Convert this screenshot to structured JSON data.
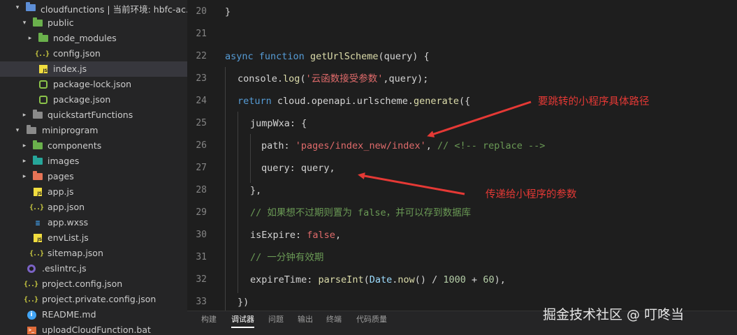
{
  "sidebar": {
    "items": [
      {
        "label": "cloudfunctions | 当前环境: hbfc-ac...",
        "icon": "folder-open-icon"
      },
      {
        "label": "public",
        "icon": "folder-open-icon"
      },
      {
        "label": "node_modules",
        "icon": "folder-icon"
      },
      {
        "label": "config.json",
        "icon": "json-icon"
      },
      {
        "label": "index.js",
        "icon": "js-icon"
      },
      {
        "label": "package-lock.json",
        "icon": "npm-icon"
      },
      {
        "label": "package.json",
        "icon": "npm-icon"
      },
      {
        "label": "quickstartFunctions",
        "icon": "folder-icon"
      },
      {
        "label": "miniprogram",
        "icon": "folder-open-icon"
      },
      {
        "label": "components",
        "icon": "folder-icon"
      },
      {
        "label": "images",
        "icon": "folder-icon"
      },
      {
        "label": "pages",
        "icon": "folder-icon"
      },
      {
        "label": "app.js",
        "icon": "js-icon"
      },
      {
        "label": "app.json",
        "icon": "json-icon"
      },
      {
        "label": "app.wxss",
        "icon": "css-icon"
      },
      {
        "label": "envList.js",
        "icon": "js-icon"
      },
      {
        "label": "sitemap.json",
        "icon": "json-icon"
      },
      {
        "label": ".eslintrc.js",
        "icon": "eslint-icon"
      },
      {
        "label": "project.config.json",
        "icon": "json-icon"
      },
      {
        "label": "project.private.config.json",
        "icon": "json-icon"
      },
      {
        "label": "README.md",
        "icon": "info-icon"
      },
      {
        "label": "uploadCloudFunction.bat",
        "icon": "bat-icon"
      }
    ],
    "selected": "index.js"
  },
  "editor": {
    "line_numbers": [
      "20",
      "21",
      "22",
      "23",
      "24",
      "25",
      "26",
      "27",
      "28",
      "29",
      "30",
      "31",
      "32",
      "33"
    ],
    "code": {
      "l20": "}",
      "l22_kw1": "async",
      "l22_kw2": "function",
      "l22_fn": "getUrlScheme",
      "l22_rest": "(query) {",
      "l23_obj": "console",
      "l23_fn": "log",
      "l23_str": "'云函数接受参数'",
      "l23_rest": ",query);",
      "l24_kw": "return",
      "l24_obj": "cloud.openapi.urlscheme.",
      "l24_fn": "generate",
      "l24_rest": "({",
      "l25_prop": "jumpWxa",
      "l25_rest": ": {",
      "l26_prop": "path",
      "l26_str": "'pages/index_new/index'",
      "l26_cm": "// <!-- replace -->",
      "l27_prop": "query",
      "l27_rest": ": query,",
      "l28": "},",
      "l29_cm": "// 如果想不过期则置为 false，并可以存到数据库",
      "l30_prop": "isExpire",
      "l30_bool": "false",
      "l31_cm": "// 一分钟有效期",
      "l32_prop": "expireTime",
      "l32_fn": "parseInt",
      "l32_obj": "Date",
      "l32_fn2": "now",
      "l32_num1": "1000",
      "l32_num2": "60",
      "l33": "})"
    }
  },
  "annotations": {
    "path_note": "要跳转的小程序具体路径",
    "query_note": "传递给小程序的参数"
  },
  "bottom_panel": {
    "tabs": [
      "构建",
      "调试器",
      "问题",
      "输出",
      "终端",
      "代码质量"
    ],
    "active": "调试器"
  },
  "watermark": "掘金技术社区 @ 叮咚当",
  "colors": {
    "arrow_red": "#e53935",
    "keyword": "#569cd6",
    "function": "#dcdcaa",
    "string": "#e06b6b",
    "comment": "#6a9955"
  }
}
